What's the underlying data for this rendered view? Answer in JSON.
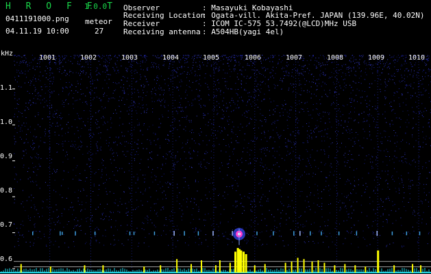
{
  "header": {
    "app_name": "H R O F F T",
    "version": "1.0.0",
    "file_name": "0411191000.png",
    "datetime": "04.11.19 10:00",
    "meteor_label": "meteor",
    "meteor_count": "27",
    "info_rows": [
      {
        "label": "Observer",
        "value": ": Masayuki Kobayashi"
      },
      {
        "label": "Receiving Location",
        "value": ": Ogata-vill. Akita-Pref. JAPAN (139.96E, 40.02N)"
      },
      {
        "label": "Receiver",
        "value": ": ICOM IC-575 53.7492(@LCD)MHz USB"
      },
      {
        "label": "Receiving antenna",
        "value": ": A504HB(yagi 4el)"
      }
    ]
  },
  "colors": {
    "background": "#000000",
    "spectrogram_noise": "#1a1f9a",
    "trace": "#ffff00",
    "baseline": "#22d8e8",
    "meteor_core": "#ff3fd0",
    "gridline": "#9a9a9a",
    "title_green": "#19d84a"
  },
  "chart_data": {
    "type": "heatmap",
    "unit_label": "kHz",
    "x_tick_labels": [
      "1001",
      "1002",
      "1003",
      "1004",
      "1005",
      "1006",
      "1007",
      "1008",
      "1009",
      "1010"
    ],
    "y_tick_labels": [
      "1.1",
      "1.0",
      "0.9",
      "0.8",
      "0.7",
      "0.6"
    ],
    "y_tick_values": [
      1.1,
      1.0,
      0.9,
      0.8,
      0.7,
      0.6
    ],
    "ylim": [
      0.585,
      1.195
    ],
    "xlim": [
      1000.12,
      1010.3
    ],
    "meteor_echo_line_khz": 0.7,
    "meteor_echoes": [
      {
        "time": 1000.58,
        "strength": 0.3
      },
      {
        "time": 1001.25,
        "strength": 0.4
      },
      {
        "time": 1001.3,
        "strength": 0.2
      },
      {
        "time": 1001.62,
        "strength": 0.4
      },
      {
        "time": 1002.1,
        "strength": 0.3
      },
      {
        "time": 1002.95,
        "strength": 0.3
      },
      {
        "time": 1003.05,
        "strength": 0.25
      },
      {
        "time": 1003.55,
        "strength": 0.3
      },
      {
        "time": 1004.03,
        "strength": 0.5
      },
      {
        "time": 1004.28,
        "strength": 0.45
      },
      {
        "time": 1004.62,
        "strength": 0.4
      },
      {
        "time": 1004.98,
        "strength": 0.5
      },
      {
        "time": 1005.45,
        "strength": 0.5
      },
      {
        "time": 1005.62,
        "strength": 1.0
      },
      {
        "time": 1006.05,
        "strength": 0.3
      },
      {
        "time": 1006.45,
        "strength": 0.4
      },
      {
        "time": 1006.95,
        "strength": 0.45
      },
      {
        "time": 1007.1,
        "strength": 0.5
      },
      {
        "time": 1007.35,
        "strength": 0.4
      },
      {
        "time": 1007.62,
        "strength": 0.35
      },
      {
        "time": 1008.05,
        "strength": 0.3
      },
      {
        "time": 1008.48,
        "strength": 0.4
      },
      {
        "time": 1008.98,
        "strength": 0.55
      },
      {
        "time": 1009.35,
        "strength": 0.3
      },
      {
        "time": 1009.7,
        "strength": 0.3
      },
      {
        "time": 1010.02,
        "strength": 0.3
      }
    ],
    "signal_peaks": [
      {
        "time": 1000.3,
        "level": 0.35
      },
      {
        "time": 1001.02,
        "level": 0.25
      },
      {
        "time": 1001.85,
        "level": 0.3
      },
      {
        "time": 1002.3,
        "level": 0.3
      },
      {
        "time": 1003.3,
        "level": 0.25
      },
      {
        "time": 1003.7,
        "level": 0.3
      },
      {
        "time": 1004.1,
        "level": 0.55
      },
      {
        "time": 1004.45,
        "level": 0.35
      },
      {
        "time": 1004.7,
        "level": 0.5
      },
      {
        "time": 1005.05,
        "level": 0.3
      },
      {
        "time": 1005.15,
        "level": 0.5
      },
      {
        "time": 1005.4,
        "level": 0.4
      },
      {
        "time": 1005.52,
        "level": 0.85
      },
      {
        "time": 1005.58,
        "level": 1.0
      },
      {
        "time": 1005.62,
        "level": 0.95
      },
      {
        "time": 1005.66,
        "level": 0.9
      },
      {
        "time": 1005.72,
        "level": 0.85
      },
      {
        "time": 1005.78,
        "level": 0.75
      },
      {
        "time": 1006.0,
        "level": 0.3
      },
      {
        "time": 1006.25,
        "level": 0.35
      },
      {
        "time": 1006.75,
        "level": 0.4
      },
      {
        "time": 1006.9,
        "level": 0.45
      },
      {
        "time": 1007.05,
        "level": 0.6
      },
      {
        "time": 1007.2,
        "level": 0.55
      },
      {
        "time": 1007.4,
        "level": 0.45
      },
      {
        "time": 1007.55,
        "level": 0.5
      },
      {
        "time": 1007.7,
        "level": 0.4
      },
      {
        "time": 1007.95,
        "level": 0.3
      },
      {
        "time": 1008.2,
        "level": 0.35
      },
      {
        "time": 1008.45,
        "level": 0.3
      },
      {
        "time": 1008.7,
        "level": 0.25
      },
      {
        "time": 1009.0,
        "level": 0.9
      },
      {
        "time": 1009.4,
        "level": 0.3
      },
      {
        "time": 1009.85,
        "level": 0.35
      },
      {
        "time": 1010.05,
        "level": 0.3
      }
    ],
    "reference_levels": [
      0.62,
      0.605,
      0.59
    ]
  }
}
